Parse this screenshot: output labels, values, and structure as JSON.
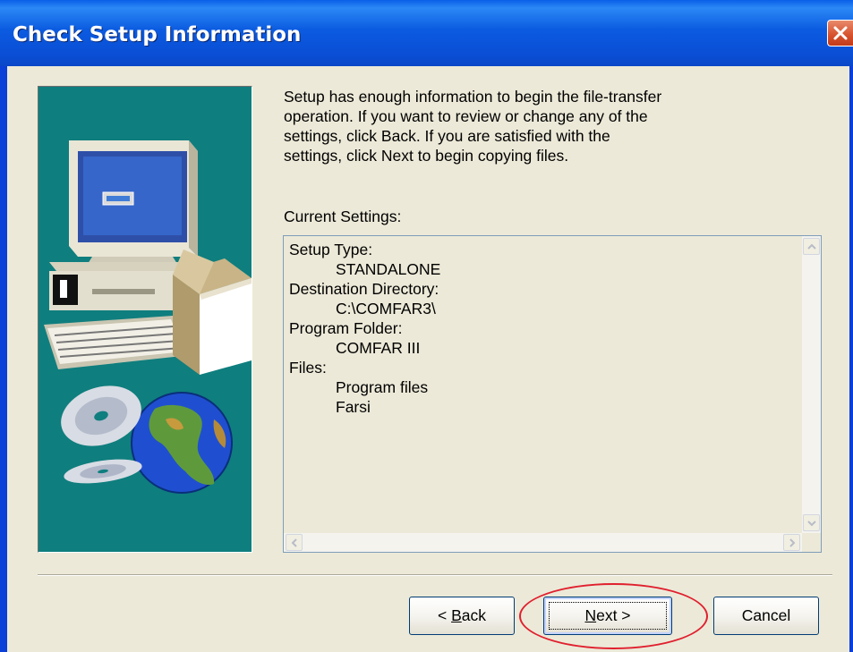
{
  "window": {
    "title": "Check Setup Information",
    "close_icon": "close-icon"
  },
  "banner": {
    "icon": "computer-setup-illustration"
  },
  "info_text": "Setup has enough information to begin the file-transfer\noperation.  If you want to review or change any of the\nsettings, click Back.  If you are satisfied with the\nsettings, click Next to begin copying files.",
  "current_settings_label": "Current Settings:",
  "settings": {
    "setup_type_label": "Setup Type:",
    "setup_type_value": "STANDALONE",
    "destination_label": "Destination Directory:",
    "destination_value": "C:\\COMFAR3\\",
    "program_folder_label": "Program Folder:",
    "program_folder_value": "COMFAR III",
    "files_label": "Files:",
    "files_values": [
      "Program files",
      "Farsi"
    ]
  },
  "buttons": {
    "back_prefix": "< ",
    "back_mnemonic": "B",
    "back_rest": "ack",
    "next_mnemonic": "N",
    "next_rest": "ext >",
    "cancel": "Cancel"
  },
  "colors": {
    "titlebar": "#0A5FE8",
    "banner_bg": "#0F7E7E",
    "annotation": "#E0202E"
  }
}
